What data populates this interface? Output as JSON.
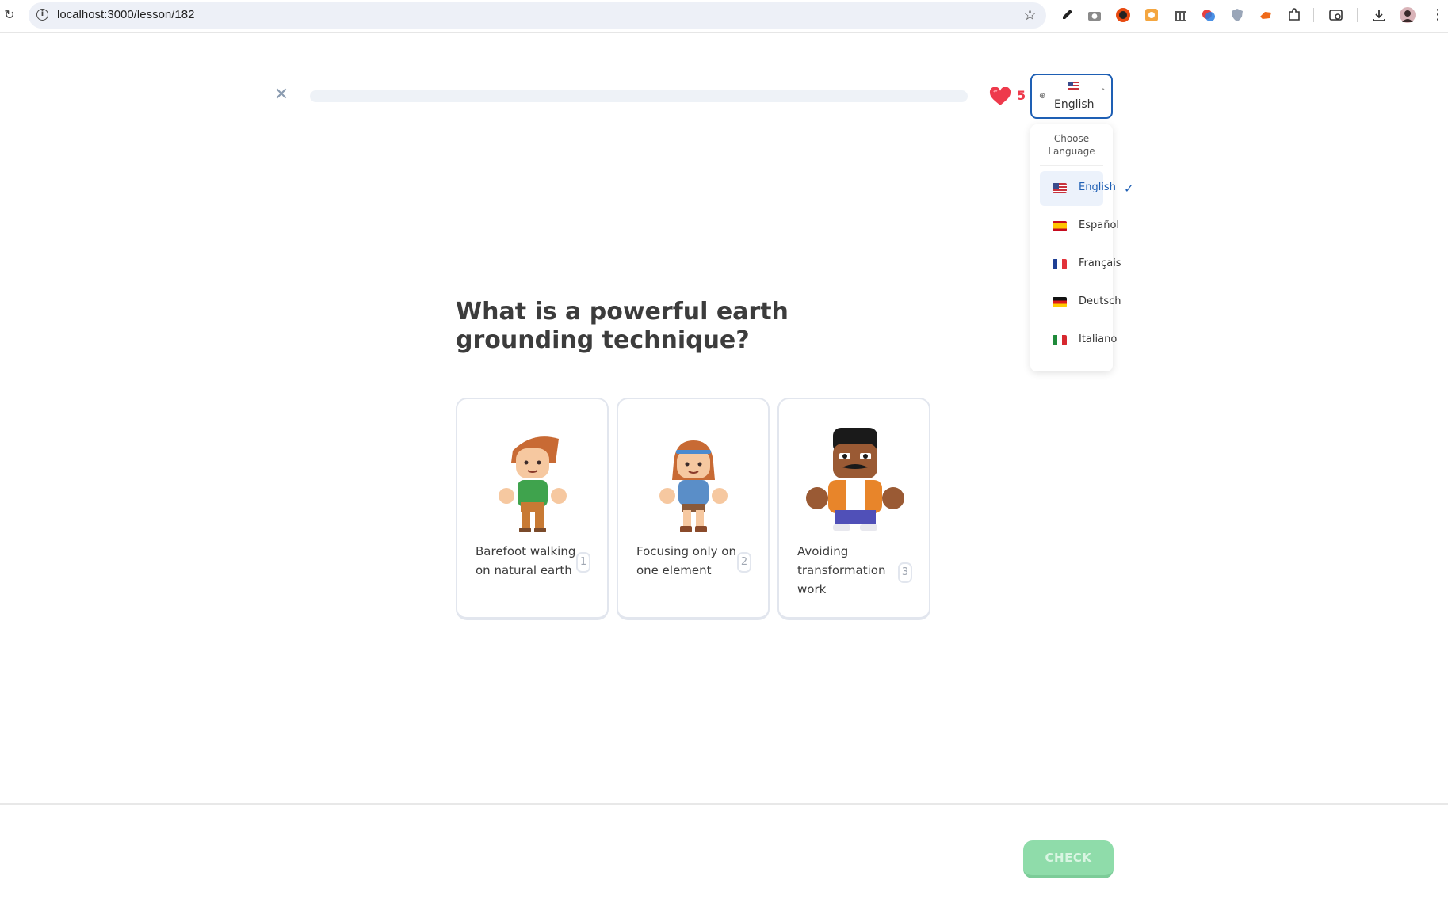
{
  "browser": {
    "url": "localhost:3000/lesson/182"
  },
  "lesson": {
    "progress_percent": 0,
    "hearts": "5",
    "question": "What is a powerful earth grounding technique?",
    "options": [
      {
        "text": "Barefoot walking on natural earth",
        "number": "1"
      },
      {
        "text": "Focusing only on one element",
        "number": "2"
      },
      {
        "text": "Avoiding transformation work",
        "number": "3"
      }
    ],
    "check_label": "CHECK"
  },
  "language": {
    "selected": "English",
    "menu_title": "Choose Language",
    "items": [
      {
        "label": "English",
        "flag": "us-flag-icon"
      },
      {
        "label": "Español",
        "flag": "es-flag-icon"
      },
      {
        "label": "Français",
        "flag": "fr-flag-icon"
      },
      {
        "label": "Deutsch",
        "flag": "de-flag-icon"
      },
      {
        "label": "Italiano",
        "flag": "it-flag-icon"
      }
    ]
  },
  "colors": {
    "accent": "#1e5fb4",
    "heart": "#ee3a4c",
    "check_disabled": "#8fdcaa"
  }
}
